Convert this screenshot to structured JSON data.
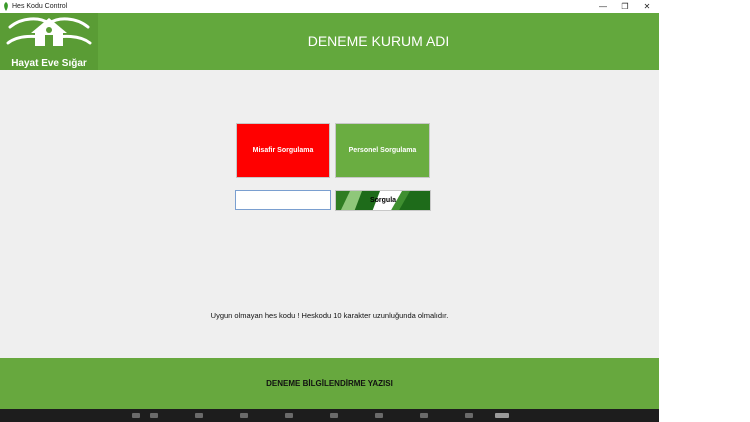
{
  "window": {
    "title": "Hes Kodu Control",
    "minimize_glyph": "—",
    "maximize_glyph": "❐",
    "close_glyph": "✕"
  },
  "header": {
    "logo_text": "Hayat Eve Sığar",
    "org_name": "DENEME KURUM ADI"
  },
  "main": {
    "guest_button": "Misafir Sorgulama",
    "staff_button": "Personel Sorgulama",
    "code_input": {
      "value": "",
      "placeholder": ""
    },
    "query_button": "Sorgula",
    "message": "Uygun olmayan hes kodu ! Heskodu 10 karakter uzunluğunda olmalıdır."
  },
  "footer": {
    "text": "DENEME BİLGİLENDİRME YAZISI"
  },
  "colors": {
    "brand_green": "#63a83d",
    "guest_red": "#ff0000",
    "staff_green": "#6aad41",
    "query_dark_green": "#1e6b1a"
  },
  "icons": [
    "app-leaf-icon",
    "house-hands-icon",
    "minimize-icon",
    "maximize-icon",
    "close-icon"
  ]
}
